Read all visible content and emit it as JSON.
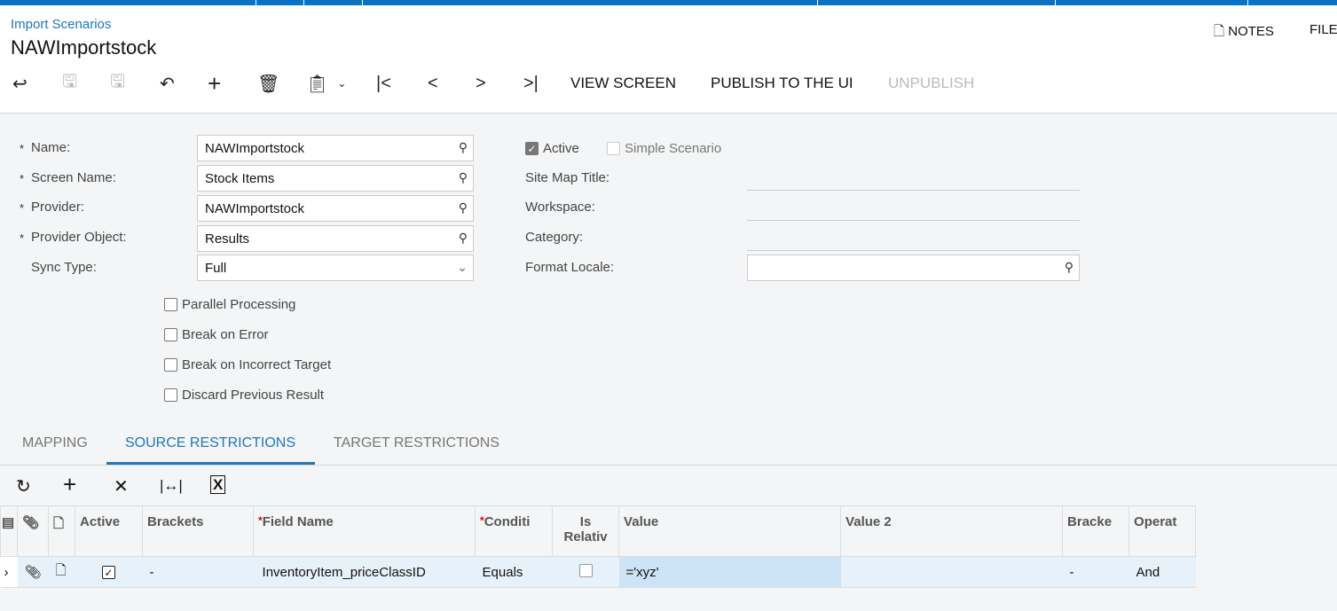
{
  "breadcrumb": "Import Scenarios",
  "title": "NAWImportstock",
  "header_actions": {
    "notes": "NOTES",
    "files": "FILE"
  },
  "toolbar": {
    "view_screen": "VIEW SCREEN",
    "publish": "PUBLISH TO THE UI",
    "unpublish": "UNPUBLISH"
  },
  "form": {
    "name_label": "Name:",
    "name_value": "NAWImportstock",
    "screen_label": "Screen Name:",
    "screen_value": "Stock Items",
    "provider_label": "Provider:",
    "provider_value": "NAWImportstock",
    "provider_obj_label": "Provider Object:",
    "provider_obj_value": "Results",
    "sync_label": "Sync Type:",
    "sync_value": "Full",
    "active_label": "Active",
    "active_checked": true,
    "simple_label": "Simple Scenario",
    "simple_checked": false,
    "sitemap_label": "Site Map Title:",
    "workspace_label": "Workspace:",
    "category_label": "Category:",
    "locale_label": "Format Locale:",
    "parallel": "Parallel Processing",
    "break_error": "Break on Error",
    "break_target": "Break on Incorrect Target",
    "discard": "Discard Previous Result"
  },
  "tabs": [
    "MAPPING",
    "SOURCE RESTRICTIONS",
    "TARGET RESTRICTIONS"
  ],
  "grid": {
    "headers": {
      "active": "Active",
      "brackets": "Brackets",
      "field": "Field Name",
      "cond": "Conditi",
      "isrel1": "Is",
      "isrel2": "Relativ",
      "value": "Value",
      "value2": "Value 2",
      "brackets2": "Bracke",
      "operator": "Operat"
    },
    "rows": [
      {
        "active": true,
        "brackets": "-",
        "field": "InventoryItem_priceClassID",
        "cond": "Equals",
        "is_relative": false,
        "value": "='xyz'",
        "value2": "",
        "brackets2": "-",
        "operator": "And"
      }
    ]
  }
}
